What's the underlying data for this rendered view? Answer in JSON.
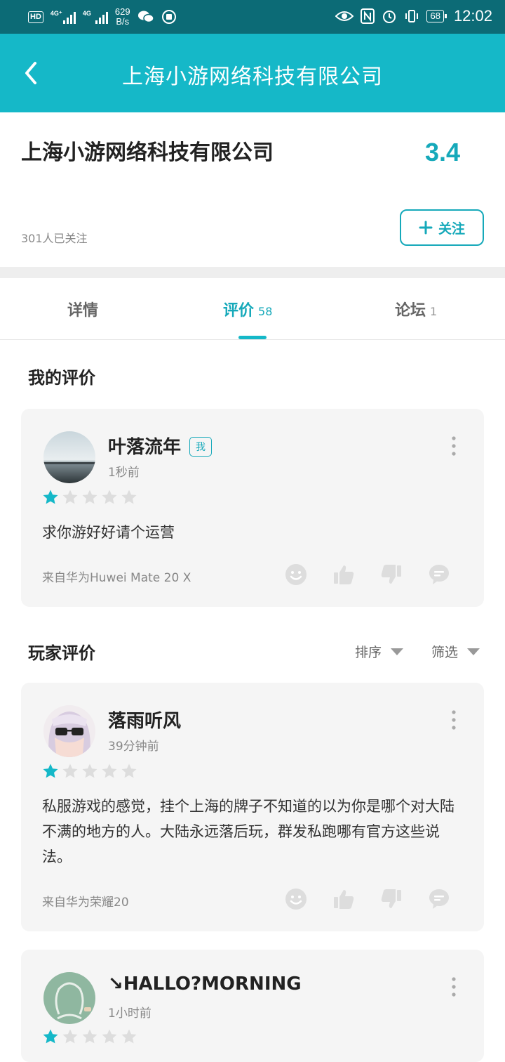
{
  "status_bar": {
    "hd": "HD",
    "net1": "4G⁺",
    "net2": "4G",
    "rate_value": "629",
    "rate_unit": "B/s",
    "battery": "68",
    "time": "12:02"
  },
  "header": {
    "title": "上海小游网络科技有限公司"
  },
  "company": {
    "name": "上海小游网络科技有限公司",
    "score": "3.4",
    "followers": "301人已关注",
    "follow_label": "关注"
  },
  "tabs": [
    {
      "label": "详情",
      "count": ""
    },
    {
      "label": "评价",
      "count": "58"
    },
    {
      "label": "论坛",
      "count": "1"
    }
  ],
  "active_tab": 1,
  "my_review": {
    "section_title": "我的评价",
    "user": "叶落流年",
    "badge": "我",
    "time": "1秒前",
    "rating": 1,
    "text": "求你游好好请个运营",
    "device": "来自华为Huwei Mate 20 X"
  },
  "player_reviews": {
    "section_title": "玩家评价",
    "sort_label": "排序",
    "filter_label": "筛选",
    "items": [
      {
        "user": "落雨听风",
        "time": "39分钟前",
        "rating": 1,
        "text": "私服游戏的感觉，挂个上海的牌子不知道的以为你是哪个对大陆不满的地方的人。大陆永远落后玩，群发私跑哪有官方这些说法。",
        "device": "来自华为荣耀20"
      },
      {
        "user": "↘HALLO?MORNING",
        "time": "1小时前",
        "rating": 1
      }
    ]
  },
  "colors": {
    "accent": "#15b8c8",
    "status_bar": "#0c6b76",
    "card_bg": "#f5f5f5",
    "star_inactive": "#dddddd"
  },
  "icons": [
    "back-arrow-icon",
    "plus-icon",
    "more-vert-icon",
    "star-icon",
    "smile-icon",
    "thumb-up-icon",
    "thumb-down-icon",
    "comment-icon",
    "chevron-down-icon"
  ]
}
